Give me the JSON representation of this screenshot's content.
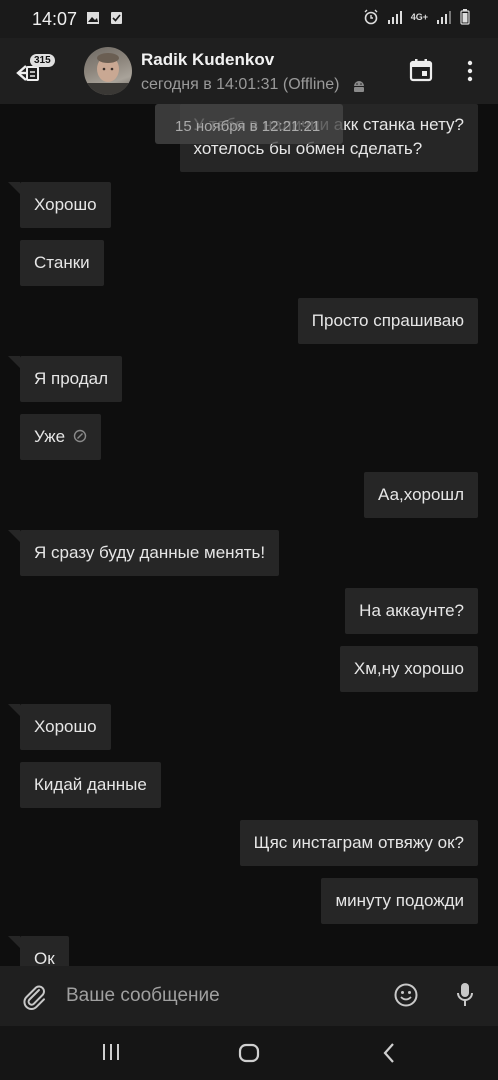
{
  "status_bar": {
    "time": "14:07",
    "network": "4G+"
  },
  "header": {
    "back_badge": "315",
    "contact_name": "Radik Kudenkov",
    "contact_status": "сегодня в 14:01:31 (Offline)"
  },
  "chat": {
    "date_chip": "15 ноября в 12:21:21",
    "messages": [
      {
        "dir": "out",
        "text_line1": "У тебя в наличии акк станка нету?",
        "text_line2": "хотелось бы обмен сделать?"
      },
      {
        "dir": "in",
        "text": "Хорошо"
      },
      {
        "dir": "in",
        "text": "Станки"
      },
      {
        "dir": "out",
        "text": "Просто спрашиваю"
      },
      {
        "dir": "in",
        "text": "Я продал"
      },
      {
        "dir": "in",
        "text": "Уже"
      },
      {
        "dir": "out",
        "text": "Аа,хорошл"
      },
      {
        "dir": "in",
        "text": "Я сразу буду данные менять!"
      },
      {
        "dir": "out",
        "text": "На аккаунте?"
      },
      {
        "dir": "out",
        "text": "Хм,ну хорошо"
      },
      {
        "dir": "in",
        "text": "Хорошо"
      },
      {
        "dir": "in",
        "text": "Кидай данные"
      },
      {
        "dir": "out",
        "text": "Щяс инстаграм отвяжу ок?"
      },
      {
        "dir": "out",
        "text": "минуту подожди"
      },
      {
        "dir": "in",
        "text": "Ок"
      }
    ]
  },
  "composer": {
    "placeholder": "Ваше сообщение"
  },
  "colors": {
    "background": "#0e0e0e",
    "bubble": "#262626",
    "header": "#1f1f1f"
  },
  "icons": [
    "back-arrow-icon",
    "calendar-icon",
    "more-vert-icon",
    "android-icon",
    "paperclip-icon",
    "emoji-icon",
    "mic-icon",
    "edited-icon"
  ]
}
